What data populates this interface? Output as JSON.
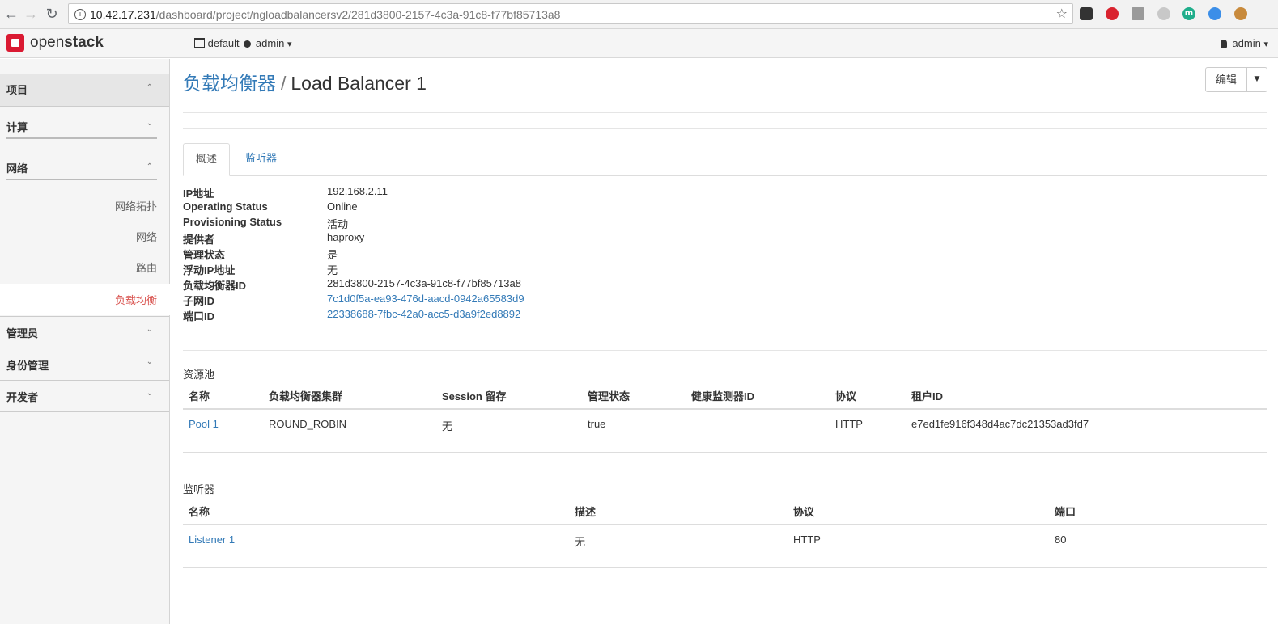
{
  "browser": {
    "url_host": "10.42.17.231",
    "url_path": "/dashboard/project/ngloadbalancersv2/281d3800-2157-4c3a-91c8-f77bf85713a8",
    "back_icon": "←",
    "forward_icon": "→",
    "reload_icon": "↻",
    "info_icon": "i",
    "star_icon": "☆",
    "ext_m_label": "m"
  },
  "header": {
    "logo_open": "open",
    "logo_stack": "stack",
    "project_domain": "default",
    "project_name": "admin",
    "user_name": "admin",
    "caret": "▾"
  },
  "sidebar": {
    "project": "项目",
    "compute": "计算",
    "network": "网络",
    "network_items": [
      "网络拓扑",
      "网络",
      "路由",
      "负载均衡"
    ],
    "admin": "管理员",
    "identity": "身份管理",
    "developer": "开发者",
    "caret_up": "⌃",
    "caret_down": "⌄",
    "active_color": "#d9534f"
  },
  "page": {
    "breadcrumb_parent": "负载均衡器",
    "breadcrumb_sep": "/",
    "title": "Load Balancer 1",
    "edit_label": "编辑",
    "edit_caret": "▼"
  },
  "tabs": [
    "概述",
    "监听器"
  ],
  "details": {
    "labels": [
      "IP地址",
      "Operating Status",
      "Provisioning Status",
      "提供者",
      "管理状态",
      "浮动IP地址",
      "负载均衡器ID",
      "子网ID",
      "端口ID"
    ],
    "values": [
      "192.168.2.11",
      "Online",
      "活动",
      "haproxy",
      "是",
      "无",
      "281d3800-2157-4c3a-91c8-f77bf85713a8",
      "7c1d0f5a-ea93-476d-aacd-0942a65583d9",
      "22338688-7fbc-42a0-acc5-d3a9f2ed8892"
    ]
  },
  "pools": {
    "title": "资源池",
    "headers": [
      "名称",
      "负载均衡器集群",
      "Session 留存",
      "管理状态",
      "健康监测器ID",
      "协议",
      "租户ID"
    ],
    "rows": [
      [
        "Pool 1",
        "ROUND_ROBIN",
        "无",
        "true",
        "",
        "HTTP",
        "e7ed1fe916f348d4ac7dc21353ad3fd7"
      ]
    ]
  },
  "listeners": {
    "title": "监听器",
    "headers": [
      "名称",
      "描述",
      "协议",
      "端口"
    ],
    "rows": [
      [
        "Listener 1",
        "无",
        "HTTP",
        "80"
      ]
    ]
  },
  "colors": {
    "link": "#337ab7",
    "logo_red": "#da1a32"
  }
}
